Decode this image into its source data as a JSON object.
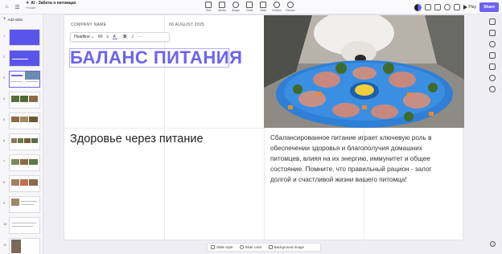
{
  "app": {
    "title": "AI - Забота о питомцах",
    "subtitle": "Private"
  },
  "toolbar": [
    {
      "label": "Text",
      "icon": "text-icon"
    },
    {
      "label": "Media",
      "icon": "media-icon"
    },
    {
      "label": "Shape",
      "icon": "shape-icon"
    },
    {
      "label": "Chart",
      "icon": "chart-icon"
    },
    {
      "label": "Table",
      "icon": "table-icon"
    },
    {
      "label": "Embed",
      "icon": "embed-icon"
    },
    {
      "label": "Record",
      "icon": "record-icon"
    }
  ],
  "header_actions": {
    "play_label": "Play",
    "share_label": "Share"
  },
  "sidebar": {
    "add_slide_label": "Add slide",
    "slide_numbers": [
      "1",
      "2",
      "3",
      "4",
      "5",
      "6",
      "7",
      "8",
      "9",
      "10",
      "11"
    ],
    "selected_slide": 3
  },
  "slide": {
    "company_name": "COMPANY NAME",
    "date": "06 AUGUST 2025",
    "headline": "БАЛАНС ПИТАНИЯ",
    "subheading": "Здоровье через питание",
    "body": "Сбалансированное питание играет ключевую роль в обеспечении здоровья и благополучия домашних питомцев, влияя на их энергию, иммунитет и общее состояние. Помните, что правильный рацион - залог долгой и счастливой жизни вашего питомца!"
  },
  "format_toolbar": {
    "style_value": "Headline",
    "font_size_value": "80",
    "bold_label": "B",
    "italic_label": "I",
    "more_label": "···"
  },
  "bottom_bar": {
    "slide_style_label": "Slide style",
    "slide_color_label": "Slide color",
    "background_image_label": "Background image"
  },
  "colors": {
    "accent": "#6b63f0",
    "share_button": "#6b63f0"
  }
}
